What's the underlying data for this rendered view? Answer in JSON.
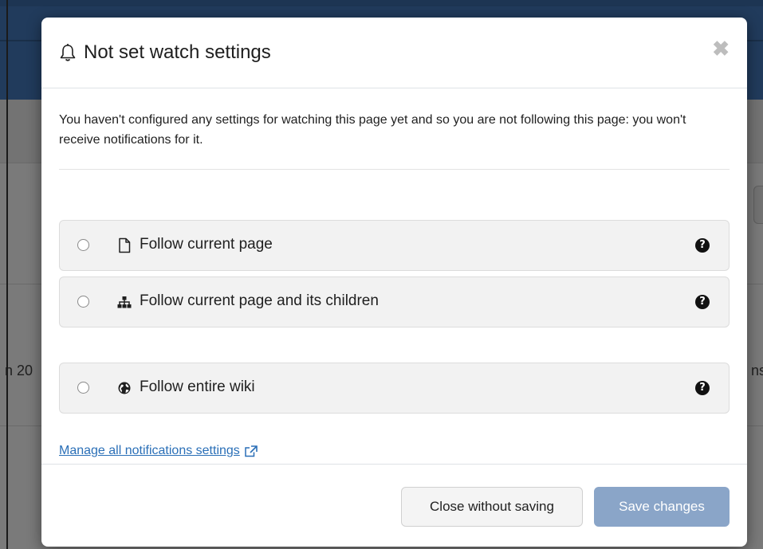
{
  "background": {
    "left_text": "n 20",
    "right_text": "ns"
  },
  "modal": {
    "title": "Not set watch settings",
    "title_icon": "bell-icon",
    "close_label": "✖",
    "intro": "You haven't configured any settings for watching this page yet and so you are not following this page: you won't receive notifications for it.",
    "options": [
      {
        "label": "Follow current page",
        "icon": "file-icon",
        "help": "?"
      },
      {
        "label": "Follow current page and its children",
        "icon": "sitemap-icon",
        "help": "?"
      },
      {
        "label": "Follow entire wiki",
        "icon": "globe-icon",
        "help": "?"
      }
    ],
    "manage_link": "Manage all notifications settings",
    "footer": {
      "close_label": "Close without saving",
      "save_label": "Save changes"
    }
  },
  "colors": {
    "link": "#2a6fb7",
    "save_button": "#8aa5c8",
    "header_bar": "#213b5c"
  }
}
